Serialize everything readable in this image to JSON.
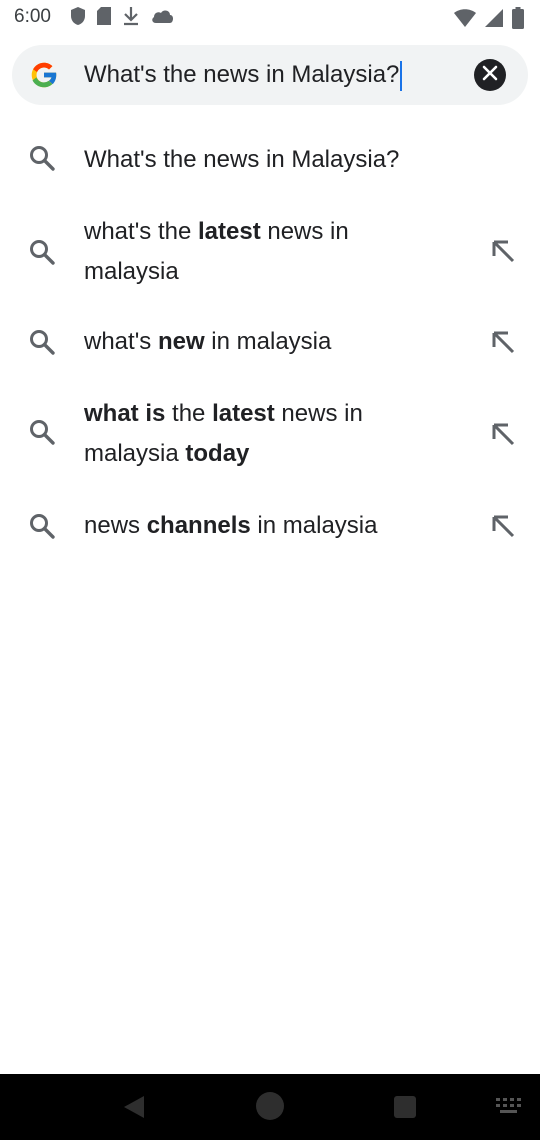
{
  "status_bar": {
    "time": "6:00",
    "left_icons": [
      "shield-icon",
      "sd-card-icon",
      "download-icon",
      "cloud-icon"
    ],
    "right_icons": [
      "wifi-icon",
      "signal-icon",
      "battery-icon"
    ]
  },
  "search": {
    "query": "What's the news in Malaysia?",
    "logo": "google-g-logo",
    "clear_icon": "close-icon"
  },
  "suggestions": [
    {
      "segments": [
        {
          "text": "What's the news in Malaysia?",
          "bold": false
        }
      ],
      "has_arrow": false
    },
    {
      "segments": [
        {
          "text": "what's the ",
          "bold": false
        },
        {
          "text": "latest",
          "bold": true
        },
        {
          "text": " news in malaysia",
          "bold": false
        }
      ],
      "has_arrow": true
    },
    {
      "segments": [
        {
          "text": "what's ",
          "bold": false
        },
        {
          "text": "new",
          "bold": true
        },
        {
          "text": " in malaysia",
          "bold": false
        }
      ],
      "has_arrow": true
    },
    {
      "segments": [
        {
          "text": "what is",
          "bold": true
        },
        {
          "text": " the ",
          "bold": false
        },
        {
          "text": "latest",
          "bold": true
        },
        {
          "text": " news in malaysia ",
          "bold": false
        },
        {
          "text": "today",
          "bold": true
        }
      ],
      "has_arrow": true
    },
    {
      "segments": [
        {
          "text": "news ",
          "bold": false
        },
        {
          "text": "channels",
          "bold": true
        },
        {
          "text": " in malaysia",
          "bold": false
        }
      ],
      "has_arrow": true
    }
  ],
  "nav_bar": {
    "icons": [
      "back-icon",
      "home-icon",
      "recents-icon",
      "keyboard-icon"
    ]
  },
  "colors": {
    "search_bar_bg": "#f1f3f4",
    "caret": "#1a73e8",
    "icon_gray": "#5f6368",
    "nav_bg": "#000000"
  }
}
